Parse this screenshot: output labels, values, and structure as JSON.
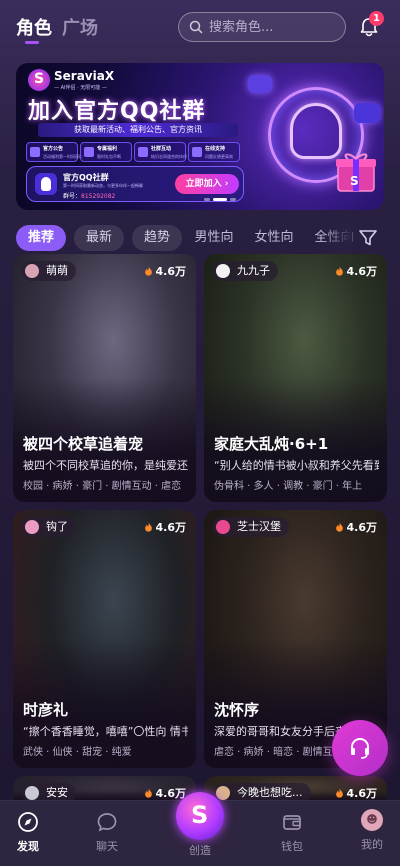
{
  "header": {
    "tab_role": "角色",
    "tab_square": "广场",
    "search_placeholder": "搜索角色...",
    "notification_count": "1"
  },
  "banner": {
    "brand_name": "SeraviaX",
    "brand_sub": "— AI伴侣 · 无限可能 —",
    "title": "加入官方QQ社群",
    "subtitle": "获取最新活动、福利公告、官方资讯",
    "features": [
      {
        "title": "官方公告",
        "sub": "活动福利第一时间获取"
      },
      {
        "title": "专属福利",
        "sub": "限时礼包不断"
      },
      {
        "title": "社群互动",
        "sub": "结识志同道合的伙伴"
      },
      {
        "title": "在线支持",
        "sub": "问题反馈更高效"
      }
    ],
    "qq_name": "官方QQ社群",
    "qq_desc": "第一时间获取最新动态，与更多伙伴一起畅聊",
    "qq_num_label": "群号：",
    "qq_num": "815292082",
    "join_label": "立即加入 ›",
    "active_dot": 1,
    "dot_count": 3
  },
  "filters": {
    "items": [
      "推荐",
      "最新",
      "趋势",
      "男性向",
      "女性向",
      "全性向"
    ],
    "active": 0
  },
  "cards": [
    {
      "creator": "萌萌",
      "hot": "4.6万",
      "title": "被四个校草追着宠",
      "desc": "被四个不同校草追的你，是纯爱还是修罗场",
      "tags": "校园 · 病娇 · 豪门 · 剧情互动 · 虐恋",
      "avatar_color": "#d8a2b5",
      "palette": [
        "#6f6780",
        "#3a3447",
        "#1c1822"
      ]
    },
    {
      "creator": "九九子",
      "hot": "4.6万",
      "title": "家庭大乱炖·6+1",
      "desc": "“别人给的情书被小叔和养父先看到了”",
      "tags": "伪骨科 · 多人 · 调教 · 豪门 · 年上",
      "avatar_color": "#f2f2f2",
      "palette": [
        "#4d5a42",
        "#2a3125",
        "#15180f"
      ]
    },
    {
      "creator": "钩了",
      "hot": "4.6万",
      "title": "时彦礼",
      "desc": "“擦个香香睡觉，嘻嘻”〇性向 情书",
      "tags": "武侠 · 仙侠 · 甜宠 · 纯爱",
      "avatar_color": "#ec9cc0",
      "palette": [
        "#3b4550",
        "#1f2126",
        "#3c1a1c"
      ]
    },
    {
      "creator": "芝士汉堡",
      "hot": "4.6万",
      "title": "沈怀序",
      "desc": "深爱的哥哥和女友分手后来找你",
      "tags": "虐恋 · 病娇 · 暗恋 · 剧情互动 · 豪门",
      "avatar_color": "#e94a8f",
      "palette": [
        "#4a3a30",
        "#2a221c",
        "#141010"
      ]
    },
    {
      "creator": "安安",
      "hot": "4.6万",
      "title": "",
      "desc": "",
      "tags": "",
      "avatar_color": "#c9c9d1",
      "palette": [
        "#3a3242",
        "#2a2430",
        "#221c28"
      ]
    },
    {
      "creator": "今晚也想吃...",
      "hot": "4.6万",
      "title": "",
      "desc": "",
      "tags": "",
      "avatar_color": "#d9b38c",
      "palette": [
        "#4a3e36",
        "#2e2620",
        "#231d19"
      ]
    }
  ],
  "nav": {
    "discover": "发现",
    "chat": "聊天",
    "create": "创造",
    "wallet": "钱包",
    "me": "我的",
    "active": "discover"
  },
  "colors": {
    "accent": "#8b5cf6",
    "hot_flame": "#ff8a2a",
    "support": "#d63ad0"
  }
}
